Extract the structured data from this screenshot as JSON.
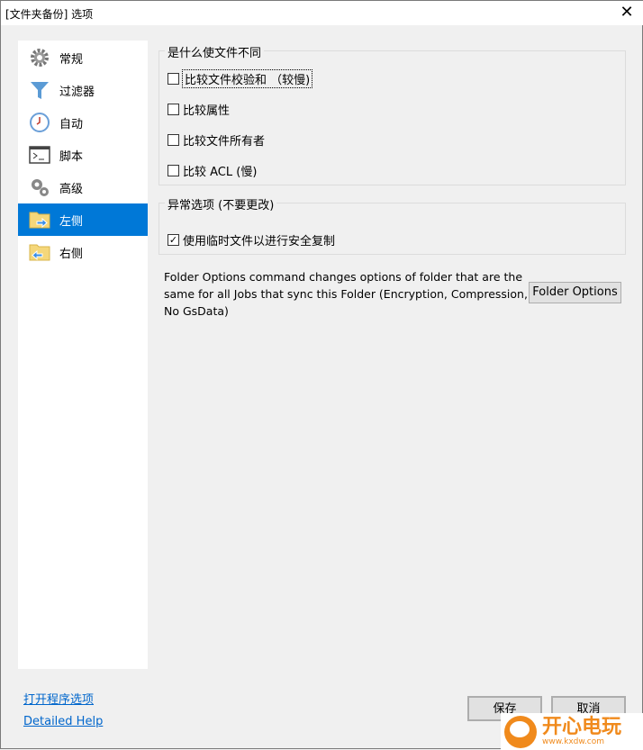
{
  "window": {
    "title": "[文件夹备份] 选项",
    "close_icon": "close-icon"
  },
  "sidebar": {
    "items": [
      {
        "label": "常规",
        "icon": "gear-icon"
      },
      {
        "label": "过滤器",
        "icon": "filter-icon"
      },
      {
        "label": "自动",
        "icon": "clock-icon"
      },
      {
        "label": "脚本",
        "icon": "terminal-icon"
      },
      {
        "label": "高级",
        "icon": "gears-icon"
      },
      {
        "label": "左侧",
        "icon": "folder-right-arrow-icon",
        "selected": true
      },
      {
        "label": "右侧",
        "icon": "folder-left-arrow-icon"
      }
    ],
    "selected_color": "#0078d7"
  },
  "group1": {
    "title": "是什么使文件不同",
    "options": [
      {
        "label": "比较文件校验和 （较慢)",
        "checked": false
      },
      {
        "label": "比较属性",
        "checked": false
      },
      {
        "label": "比较文件所有者",
        "checked": false
      },
      {
        "label": "比较 ACL (慢)",
        "checked": false
      }
    ]
  },
  "group2": {
    "title": "异常选项 (不要更改)",
    "options": [
      {
        "label": "使用临时文件以进行安全复制",
        "checked": true
      }
    ]
  },
  "note": "Folder Options command changes options of folder that are the same for all Jobs that sync this  Folder (Encryption, Compression, No GsData)",
  "folder_options_button": "Folder Options",
  "links": {
    "program_options": "打开程序选项",
    "help": "Detailed Help"
  },
  "buttons": {
    "save": "保存",
    "cancel": "取消"
  },
  "watermark": {
    "text": "开心电玩",
    "url": "www.kxdw.com"
  }
}
